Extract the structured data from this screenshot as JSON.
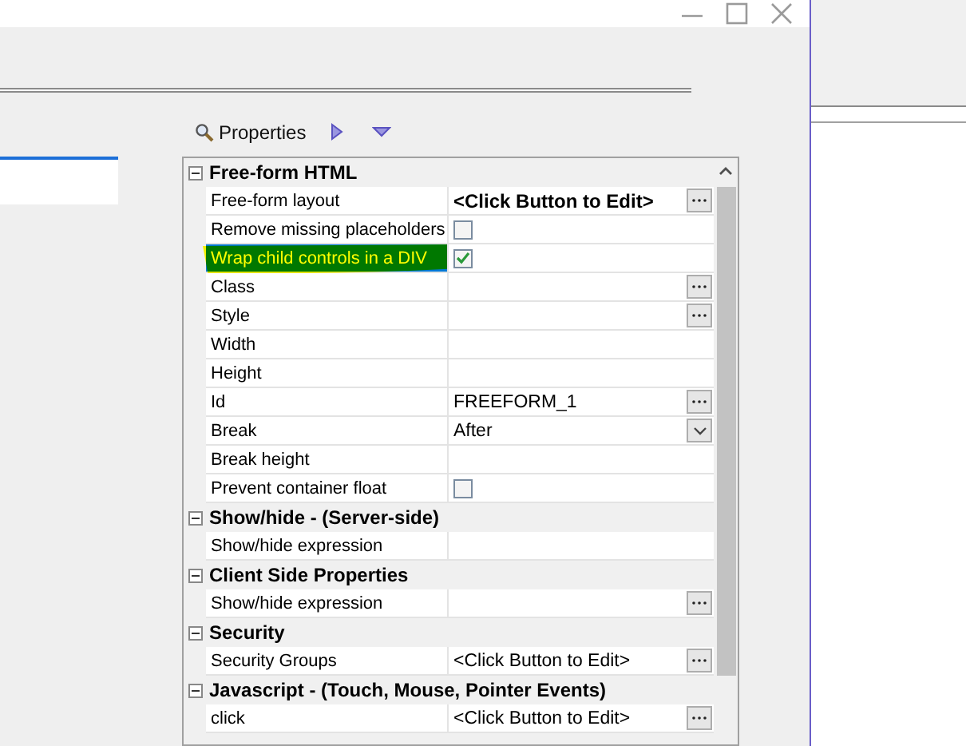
{
  "panel": {
    "title": "Properties"
  },
  "groups": [
    {
      "title": "Free-form HTML",
      "expanded": true,
      "rows": [
        {
          "name": "Free-form layout",
          "kind": "text",
          "value": "<Click Button to Edit>",
          "bold": true,
          "button": {
            "kind": "ellipsis"
          },
          "selected": false
        },
        {
          "name": "Remove missing placeholders",
          "kind": "checkbox",
          "checked": false,
          "selected": false
        },
        {
          "name": "Wrap child controls in a DIV",
          "kind": "checkbox",
          "checked": true,
          "selected": true
        },
        {
          "name": "Class",
          "kind": "text",
          "button": {
            "kind": "ellipsis"
          },
          "selected": false
        },
        {
          "name": "Style",
          "kind": "text",
          "button": {
            "kind": "ellipsis"
          },
          "selected": false
        },
        {
          "name": "Width",
          "kind": "text",
          "selected": false
        },
        {
          "name": "Height",
          "kind": "text",
          "selected": false
        },
        {
          "name": "Id",
          "kind": "text",
          "value": "FREEFORM_1",
          "button": {
            "kind": "ellipsis"
          },
          "selected": false
        },
        {
          "name": "Break",
          "kind": "text",
          "value": "After",
          "button": {
            "kind": "dropdown"
          },
          "selected": false
        },
        {
          "name": "Break height",
          "kind": "text",
          "selected": false
        },
        {
          "name": "Prevent container float",
          "kind": "checkbox",
          "checked": false,
          "selected": false
        }
      ]
    },
    {
      "title": "Show/hide - (Server-side)",
      "expanded": true,
      "rows": [
        {
          "name": "Show/hide expression",
          "kind": "text",
          "selected": false
        }
      ]
    },
    {
      "title": "Client Side Properties",
      "expanded": true,
      "rows": [
        {
          "name": "Show/hide expression",
          "kind": "text",
          "button": {
            "kind": "ellipsis"
          },
          "selected": false
        }
      ]
    },
    {
      "title": "Security",
      "expanded": true,
      "rows": [
        {
          "name": "Security Groups",
          "kind": "text",
          "value": "<Click Button to Edit>",
          "button": {
            "kind": "ellipsis"
          },
          "selected": false
        }
      ]
    },
    {
      "title": "Javascript - (Touch, Mouse, Pointer Events)",
      "expanded": true,
      "rows": [
        {
          "name": "click",
          "kind": "text",
          "value": "<Click Button to Edit>",
          "button": {
            "kind": "ellipsis"
          },
          "selected": false
        }
      ]
    }
  ]
}
